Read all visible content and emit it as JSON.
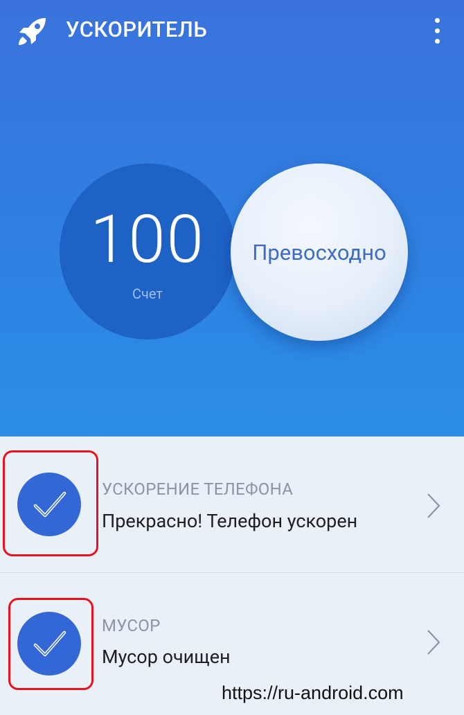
{
  "app": {
    "title": "УСКОРИТЕЛЬ",
    "logo_icon": "rocket-icon",
    "menu_icon": "more-vert-icon"
  },
  "score": {
    "value": "100",
    "label": "Счет"
  },
  "grade": {
    "text": "Превосходно"
  },
  "items": [
    {
      "category": "УСКОРЕНИЕ ТЕЛЕФОНА",
      "description": "Прекрасно! Телефон ускорен",
      "icon": "check-icon"
    },
    {
      "category": "МУСОР",
      "description": "Мусор очищен",
      "icon": "check-icon"
    }
  ],
  "watermark": "https://ru-android.com",
  "colors": {
    "header_top": "#3a72dc",
    "header_bottom": "#2b8ee6",
    "score_circle": "#1e62c6",
    "check_circle": "#3367d6",
    "highlight": "#e8121e",
    "list_bg": "#e9f0f8"
  }
}
